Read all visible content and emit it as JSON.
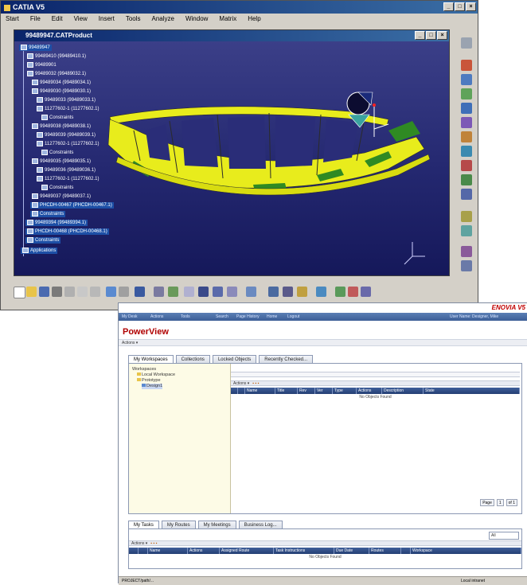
{
  "catia": {
    "title": "CATIA V5",
    "menu": [
      "Start",
      "File",
      "Edit",
      "View",
      "Insert",
      "Tools",
      "Analyze",
      "Window",
      "Matrix",
      "Help"
    ],
    "window_buttons": [
      "_",
      "□",
      "×"
    ],
    "product_title": "99489947.CATProduct",
    "tree": [
      "99489947",
      "99489410 (99489410.1)",
      "99489901",
      "99489032 (99489032.1)",
      "99489034 (99489034.1)",
      "99489030 (99489030.1)",
      "99489033 (99489033.1)",
      "11277602-1 (11277602.1)",
      "Constraints",
      "99489038 (99489038.1)",
      "99489039 (99489039.1)",
      "11277602-1 (11277602.1)",
      "Constraints",
      "99489035 (99489035.1)",
      "99489036 (99489036.1)",
      "11277602-1 (11277602.1)",
      "Constraints",
      "99489037 (99489037.1)",
      "PHCDH-00467 (PHCDH-00467.1)",
      "Constraints",
      "99489394 (99489394.1)",
      "PHCDH-00468 (PHCDH-00468.1)",
      "Constraints",
      "Applications"
    ],
    "colors": {
      "titlebar": "#0a246a",
      "viewport_top": "#3b3f88",
      "viewport_bottom": "#15185a",
      "part_yellow": "#e8ec1c",
      "part_green": "#2f8a23"
    }
  },
  "powerview": {
    "brand": "ENOVIA V5",
    "nav": [
      "My Desk",
      "Actions",
      "Tools",
      "Search",
      "Page History",
      "Home",
      "Logout",
      "User Name: Designer, Mike"
    ],
    "title": "PowerView",
    "actions_label": "Actions ▾",
    "tabs": [
      "My Workspaces",
      "Collections",
      "Locked Objects",
      "Recently Checked..."
    ],
    "ws_tree": [
      "Workspaces",
      "Local Workspace",
      "Prototype",
      "Design1"
    ],
    "actions_strip": "Actions ▾",
    "table_headers": [
      "",
      "",
      "Name",
      "Title",
      "Rev",
      "Ver",
      "Type",
      "Actions",
      "Description",
      "State"
    ],
    "no_objects": "No Objects Found",
    "pager": [
      "Page",
      "1",
      "of 1"
    ],
    "task_tabs": [
      "My Tasks",
      "My Routes",
      "My Meetings",
      "Business Log..."
    ],
    "task_select": "All",
    "task_headers": [
      "",
      "",
      "Name",
      "Actions",
      "Assigned Route",
      "Task Instructions",
      "Due Date",
      "Routes",
      "",
      "Workspace"
    ],
    "task_no_objects": "No Objects Found",
    "status": "PROJECT/path/...",
    "status_zone": "Local intranet",
    "colors": {
      "nav": "#3c5e96",
      "title": "#b00000",
      "brand": "#c00000",
      "table_header": "#243f74",
      "tree_bg": "#fdfbe6"
    }
  }
}
